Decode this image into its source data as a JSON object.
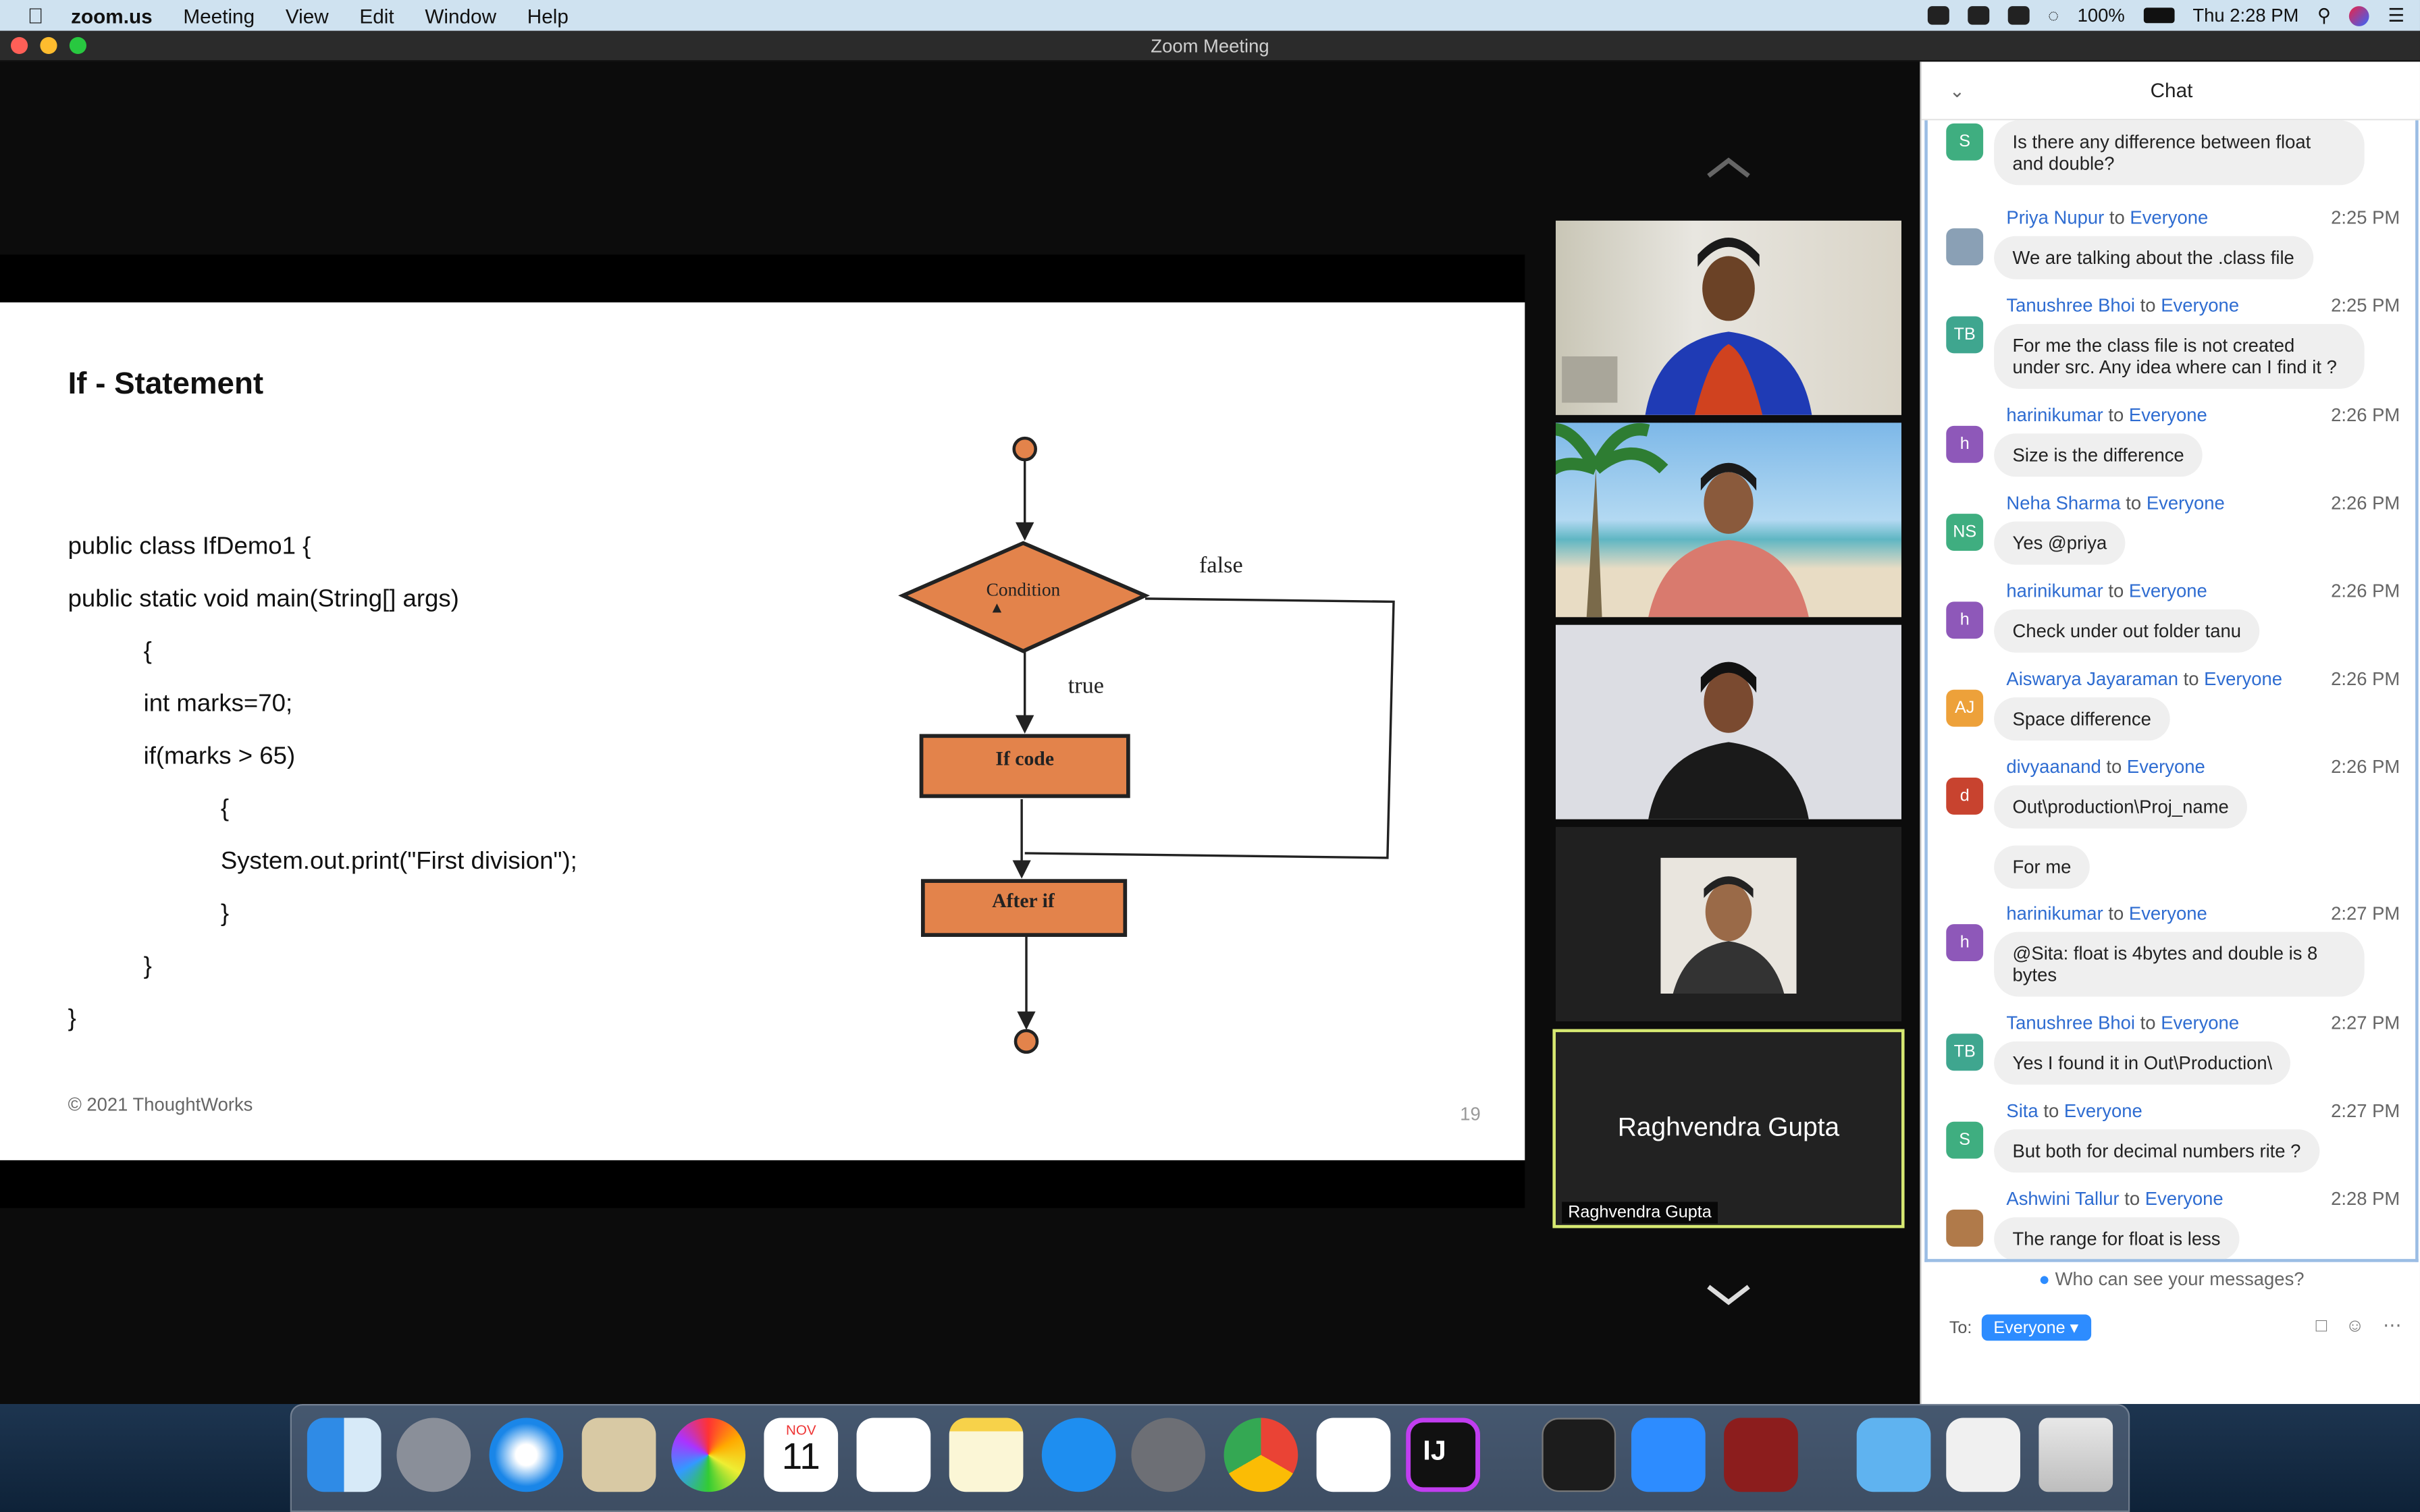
{
  "menubar": {
    "app": "zoom.us",
    "items": [
      "Meeting",
      "View",
      "Edit",
      "Window",
      "Help"
    ],
    "battery": "100%",
    "datetime": "Thu 2:28 PM"
  },
  "window": {
    "title": "Zoom Meeting"
  },
  "slide": {
    "title": "If - Statement",
    "code": [
      "public class IfDemo1 {",
      "public static void main(String[] args)",
      "{",
      "int marks=70;",
      "if(marks > 65)",
      "{",
      "System.out.print(\"First division\");",
      "}",
      "}",
      "}"
    ],
    "flowchart": {
      "condition": "Condition",
      "false_label": "false",
      "true_label": "true",
      "if_code": "If code",
      "after_if": "After if"
    },
    "footer": "© 2021 ThoughtWorks",
    "page": "19"
  },
  "active_speaker": {
    "name": "Raghvendra Gupta",
    "tag": "Raghvendra Gupta"
  },
  "chat": {
    "title": "Chat",
    "first_message": "Is there any difference between float and double?",
    "messages": [
      {
        "sender": "Priya Nupur",
        "time": "2:25 PM",
        "text": "We are talking about the .class file",
        "initials": "",
        "color": "#8aa0b5"
      },
      {
        "sender": "Tanushree Bhoi",
        "time": "2:25 PM",
        "text": "For me the class file is not created under src. Any idea where can I find it ?",
        "initials": "TB",
        "color": "#3fa68f"
      },
      {
        "sender": "harinikumar",
        "time": "2:26 PM",
        "text": "Size is the difference",
        "initials": "h",
        "color": "#8e58b9"
      },
      {
        "sender": "Neha Sharma",
        "time": "2:26 PM",
        "text": "Yes @priya",
        "initials": "NS",
        "color": "#3fae80"
      },
      {
        "sender": "harinikumar",
        "time": "2:26 PM",
        "text": "Check under out folder tanu",
        "initials": "h",
        "color": "#8e58b9"
      },
      {
        "sender": "Aiswarya Jayaraman",
        "time": "2:26 PM",
        "text": "Space difference",
        "initials": "AJ",
        "color": "#eda13a"
      },
      {
        "sender": "divyaanand",
        "time": "2:26 PM",
        "text": "Out\\production\\Proj_name",
        "initials": "d",
        "color": "#c8432f"
      },
      {
        "sender": "harinikumar",
        "time": "2:27 PM",
        "text": "@Sita: float is 4bytes and double is 8 bytes",
        "initials": "h",
        "color": "#8e58b9"
      },
      {
        "sender": "Tanushree Bhoi",
        "time": "2:27 PM",
        "text": "Yes I found it in Out\\Production\\",
        "initials": "TB",
        "color": "#3fa68f"
      },
      {
        "sender": "Sita",
        "time": "2:27 PM",
        "text": "But both for decimal numbers rite ?",
        "initials": "S",
        "color": "#3fae80"
      },
      {
        "sender": "Ashwini Tallur",
        "time": "2:28 PM",
        "text": "The range for float is less",
        "initials": "",
        "color": "#b07a4a"
      }
    ],
    "followup": "For me",
    "to_word": "to",
    "recipient": "Everyone",
    "first_initial": "S",
    "visibility": "Who can see your messages?",
    "to_label": "To:",
    "to_value": "Everyone"
  },
  "dock": {
    "calendar_month": "NOV",
    "calendar_day": "11",
    "jetbrains": "IJ"
  }
}
